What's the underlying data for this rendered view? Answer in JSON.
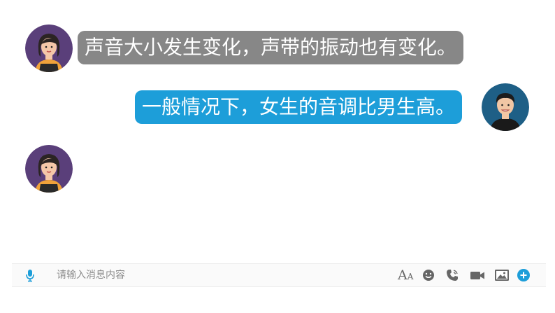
{
  "chat": {
    "messages": [
      {
        "side": "left",
        "text": "声音大小发生变化，声带的振动也有变化。"
      },
      {
        "side": "right",
        "text": "一般情况下，女生的音调比男生高。"
      }
    ]
  },
  "input_bar": {
    "placeholder": "请输入消息内容",
    "font_glyph_big": "A",
    "font_glyph_small": "A",
    "icons": [
      "mic-icon",
      "font-size-icon",
      "emoji-icon",
      "voice-call-icon",
      "video-call-icon",
      "image-icon",
      "add-icon"
    ]
  },
  "colors": {
    "left_bubble": "#878787",
    "right_bubble": "#1d9ed9",
    "accent": "#1d9ed9",
    "icon_gray": "#666666"
  }
}
